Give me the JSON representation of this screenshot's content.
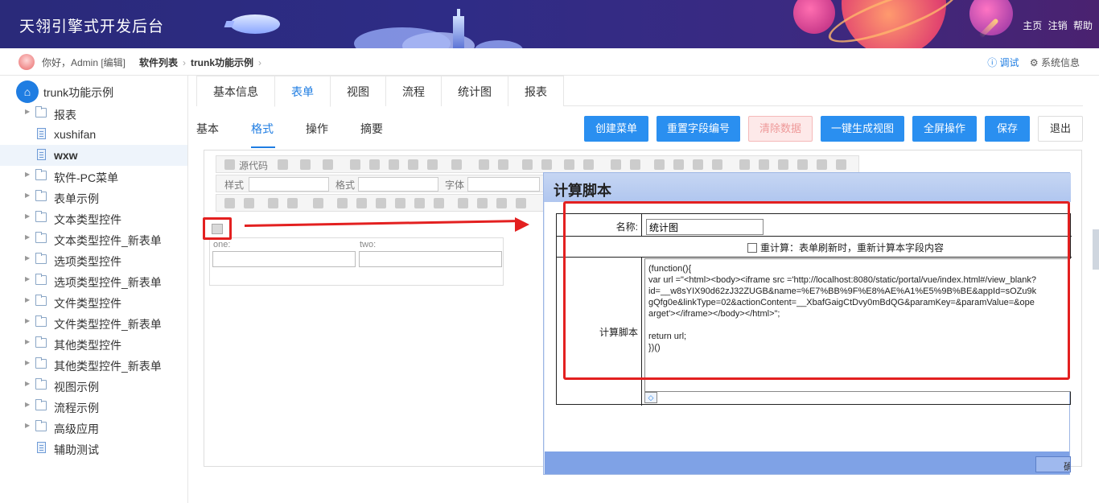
{
  "header": {
    "title": "天翎引擎式开发后台",
    "links": [
      "主页",
      "注销",
      "帮助"
    ]
  },
  "breadcrumb": {
    "greeting": "你好，Admin [编辑]",
    "items": [
      "软件列表",
      "trunk功能示例"
    ],
    "debug": "调试",
    "system": "系统信息"
  },
  "sidebar": {
    "root": "trunk功能示例",
    "items": [
      {
        "label": "报表",
        "type": "folder"
      },
      {
        "label": "xushifan",
        "type": "file"
      },
      {
        "label": "wxw",
        "type": "file",
        "selected": true
      },
      {
        "label": "软件-PC菜单",
        "type": "folder"
      },
      {
        "label": "表单示例",
        "type": "folder"
      },
      {
        "label": "文本类型控件",
        "type": "folder"
      },
      {
        "label": "文本类型控件_新表单",
        "type": "folder"
      },
      {
        "label": "选项类型控件",
        "type": "folder"
      },
      {
        "label": "选项类型控件_新表单",
        "type": "folder"
      },
      {
        "label": "文件类型控件",
        "type": "folder"
      },
      {
        "label": "文件类型控件_新表单",
        "type": "folder"
      },
      {
        "label": "其他类型控件",
        "type": "folder"
      },
      {
        "label": "其他类型控件_新表单",
        "type": "folder"
      },
      {
        "label": "视图示例",
        "type": "folder"
      },
      {
        "label": "流程示例",
        "type": "folder"
      },
      {
        "label": "高级应用",
        "type": "folder"
      },
      {
        "label": "辅助测试",
        "type": "file"
      }
    ]
  },
  "tabs": [
    "基本信息",
    "表单",
    "视图",
    "流程",
    "统计图",
    "报表"
  ],
  "subtabs": [
    "基本",
    "格式",
    "操作",
    "摘要"
  ],
  "actions": {
    "create_menu": "创建菜单",
    "reset_field": "重置字段编号",
    "clear_data": "清除数据",
    "gen_view": "一键生成视图",
    "fullscreen": "全屏操作",
    "save": "保存",
    "exit": "退出"
  },
  "editor": {
    "source": "源代码",
    "style": "样式",
    "format": "格式",
    "font": "字体",
    "field_one": "one:",
    "field_two": "two:"
  },
  "dialog": {
    "title": "计算脚本",
    "name_label": "名称:",
    "name_value": "统计图",
    "recalc_label": "重计算：表单刷新时，重新计算本字段内容",
    "script_label": "计算脚本",
    "script_code": "(function(){\nvar url =\"<html><body><iframe src ='http://localhost:8080/static/portal/vue/index.html#/view_blank?\nid=__w8sYIX90d62zJ32ZUGB&name=%E7%BB%9F%E8%AE%A1%E5%9B%BE&appId=sOZu9k\ngQfg0e&linkType=02&actionContent=__XbafGaigCtDvy0mBdQG&paramKey=&paramValue=&ope\narget'></iframe></body></html>\";\n\nreturn url;\n})()",
    "ok_label": "确"
  },
  "colors": {
    "accent": "#1f7de2",
    "button": "#2a8ff0",
    "annotation": "#e32020"
  }
}
